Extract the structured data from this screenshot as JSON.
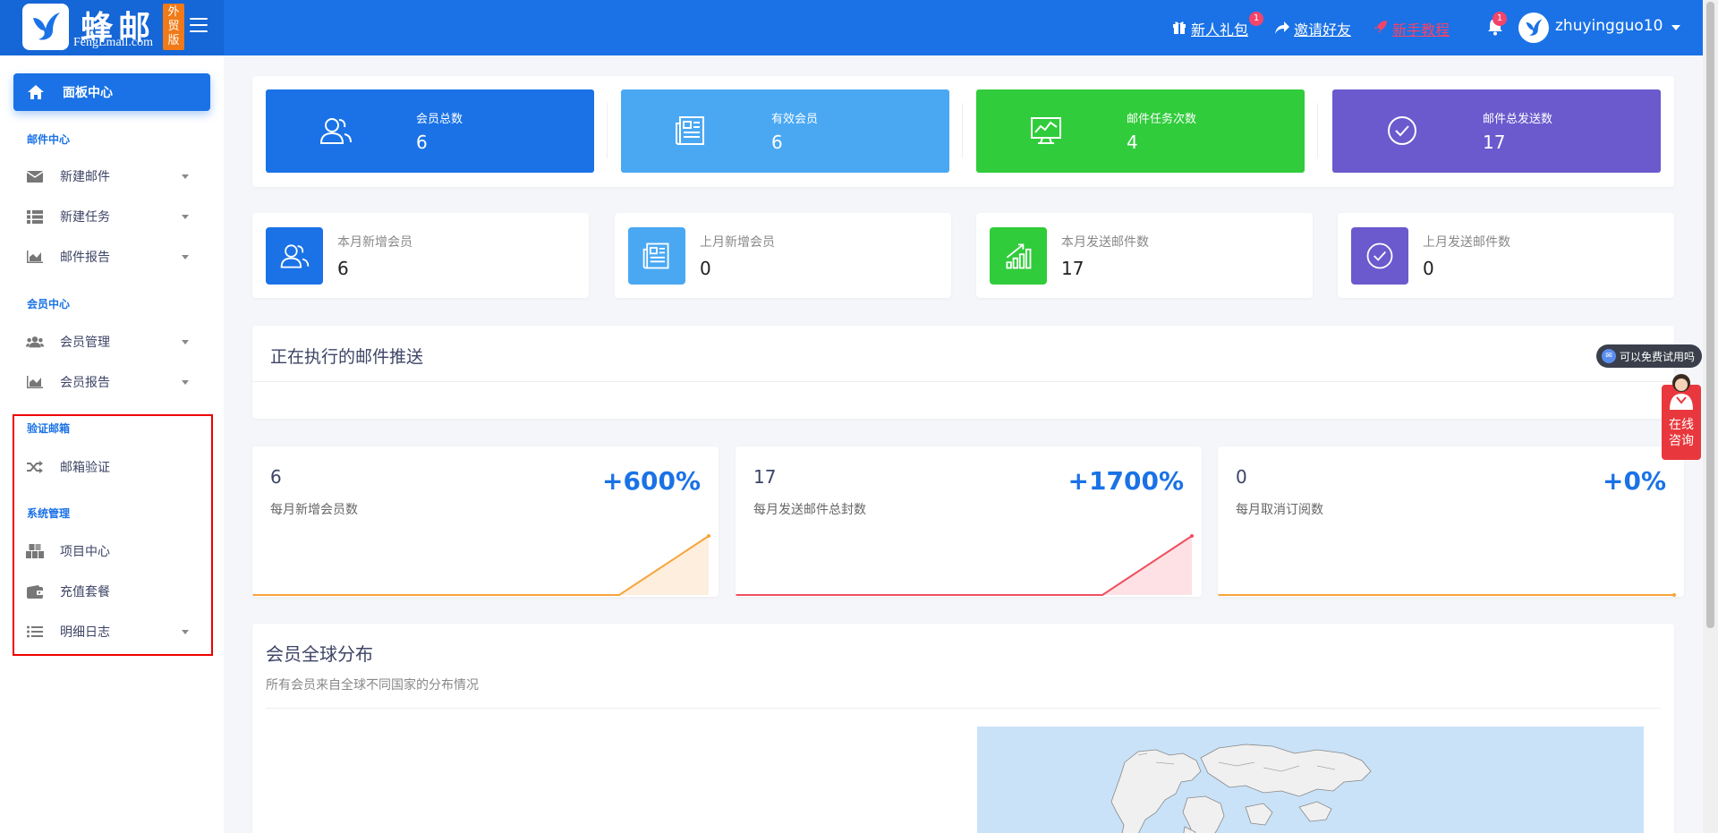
{
  "brand": {
    "name": "蜂邮",
    "sub": "FengEmail.com",
    "badge": "外贸版",
    "primary_color": "#1a72e6"
  },
  "header": {
    "links": [
      {
        "label": "新人礼包",
        "icon": "gift-icon",
        "badge": "1"
      },
      {
        "label": "邀请好友",
        "icon": "share-icon"
      },
      {
        "label": "新手教程",
        "icon": "rocket-icon"
      }
    ],
    "notifications_badge": "1",
    "username": "zhuyingguo10"
  },
  "sidebar": {
    "active": {
      "label": "面板中心",
      "icon": "home-icon"
    },
    "sections": [
      {
        "title": "邮件中心",
        "items": [
          {
            "label": "新建邮件",
            "icon": "envelope-icon",
            "has_caret": true
          },
          {
            "label": "新建任务",
            "icon": "list-icon",
            "has_caret": true
          },
          {
            "label": "邮件报告",
            "icon": "area-chart-icon",
            "has_caret": true
          }
        ]
      },
      {
        "title": "会员中心",
        "items": [
          {
            "label": "会员管理",
            "icon": "users-icon",
            "has_caret": true
          },
          {
            "label": "会员报告",
            "icon": "area-chart-icon",
            "has_caret": true
          }
        ]
      },
      {
        "title": "验证邮箱",
        "items": [
          {
            "label": "邮箱验证",
            "icon": "shuffle-icon",
            "has_caret": false
          }
        ]
      },
      {
        "title": "系统管理",
        "items": [
          {
            "label": "项目中心",
            "icon": "cubes-icon",
            "has_caret": false
          },
          {
            "label": "充值套餐",
            "icon": "wallet-icon",
            "has_caret": false
          },
          {
            "label": "明细日志",
            "icon": "list-ul-icon",
            "has_caret": true
          }
        ]
      }
    ]
  },
  "stat_tiles": [
    {
      "label": "会员总数",
      "value": "6",
      "color": "#1a72e6",
      "icon": "users-outline-icon"
    },
    {
      "label": "有效会员",
      "value": "6",
      "color": "#4aa8f3",
      "icon": "newspaper-icon"
    },
    {
      "label": "邮件任务次数",
      "value": "4",
      "color": "#30cc3b",
      "icon": "monitor-chart-icon"
    },
    {
      "label": "邮件总发送数",
      "value": "17",
      "color": "#6a5acd",
      "icon": "check-circle-icon"
    }
  ],
  "mini_stats": [
    {
      "label": "本月新增会员",
      "value": "6",
      "color": "#1a72e6",
      "icon": "users-outline-icon"
    },
    {
      "label": "上月新增会员",
      "value": "0",
      "color": "#4aa8f3",
      "icon": "newspaper-icon"
    },
    {
      "label": "本月发送邮件数",
      "value": "17",
      "color": "#30cc3b",
      "icon": "bar-growth-icon"
    },
    {
      "label": "上月发送邮件数",
      "value": "0",
      "color": "#6a5acd",
      "icon": "check-circle-icon"
    }
  ],
  "executing": {
    "title": "正在执行的邮件推送"
  },
  "spark_cards": [
    {
      "value": "6",
      "label": "每月新增会员数",
      "percent": "+600%",
      "color": "#f7a43a",
      "fill": "#fdeedd"
    },
    {
      "value": "17",
      "label": "每月发送邮件总封数",
      "percent": "+1700%",
      "color": "#ef4f5f",
      "fill": "#fde1e4"
    },
    {
      "value": "0",
      "label": "每月取消订阅数",
      "percent": "+0%",
      "color": "#f7a43a",
      "fill": "#fdeedd"
    }
  ],
  "geo": {
    "title": "会员全球分布",
    "subtitle": "所有会员来自全球不同国家的分布情况"
  },
  "floating": {
    "chat_label": "可以免费试用吗",
    "consult_label": "在线咨询"
  }
}
